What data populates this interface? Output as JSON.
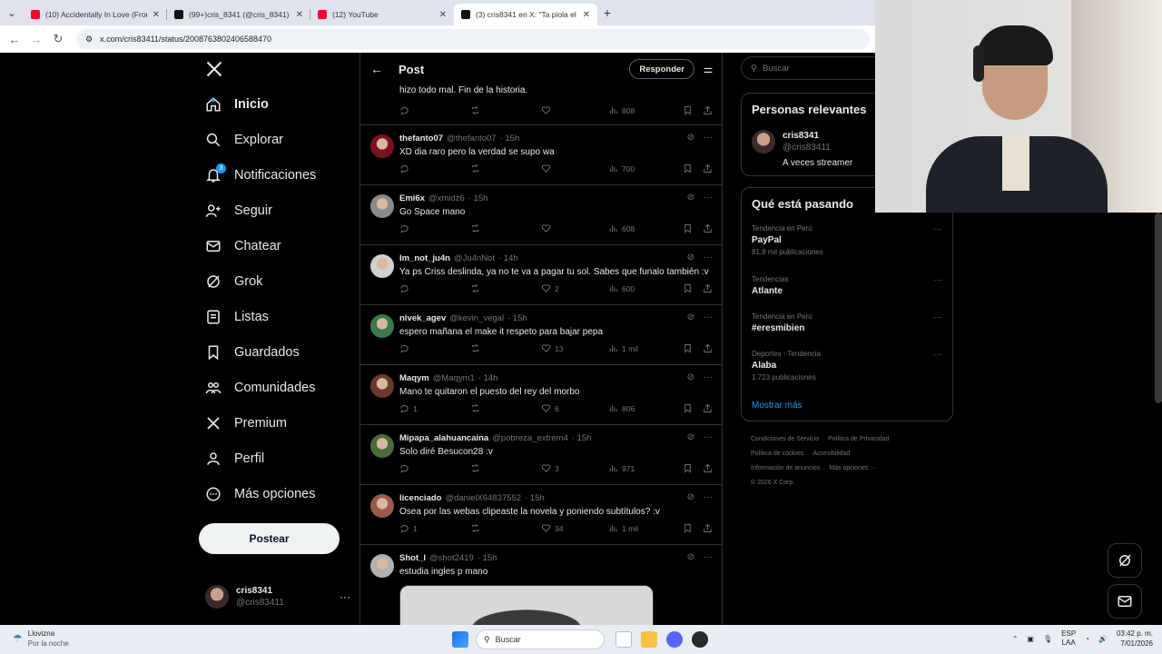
{
  "browser": {
    "tabs": [
      {
        "title": "(10) Accidentally In Love (From",
        "color": "#ff0033"
      },
      {
        "title": "(99+)cris_8341 (@cris_8341) | T",
        "color": "#111111"
      },
      {
        "title": "(12) YouTube",
        "color": "#ff0033"
      },
      {
        "title": "(3) cris8341 en X: \"Ta piola el ch",
        "color": "#111111"
      }
    ],
    "url": "x.com/cris83411/status/2008763802406588470"
  },
  "nav": {
    "items": [
      {
        "label": "Inicio",
        "icon": "home-icon"
      },
      {
        "label": "Explorar",
        "icon": "search-icon"
      },
      {
        "label": "Notificaciones",
        "icon": "bell-icon",
        "badge": "3"
      },
      {
        "label": "Seguir",
        "icon": "add-person-icon"
      },
      {
        "label": "Chatear",
        "icon": "mail-icon"
      },
      {
        "label": "Grok",
        "icon": "grok-icon"
      },
      {
        "label": "Listas",
        "icon": "list-icon"
      },
      {
        "label": "Guardados",
        "icon": "bookmark-icon"
      },
      {
        "label": "Comunidades",
        "icon": "people-icon"
      },
      {
        "label": "Premium",
        "icon": "x-icon"
      },
      {
        "label": "Perfil",
        "icon": "person-icon"
      },
      {
        "label": "Más opciones",
        "icon": "more-circle-icon"
      }
    ],
    "post_label": "Postear",
    "user": {
      "name": "cris8341",
      "handle": "@cris83411"
    }
  },
  "feed": {
    "title": "Post",
    "reply_label": "Responder",
    "partial_text": "hizo todo mal. Fin de la historia.",
    "partial_views": "808",
    "tweets": [
      {
        "name": "thefanto07",
        "handle": "@thefanto07",
        "time": "· 15h",
        "text": "XD dia raro pero la verdad se supo wa",
        "replies": "",
        "likes": "",
        "views": "700",
        "avatar": "#7a1020"
      },
      {
        "name": "Emi6x",
        "handle": "@xmidz6",
        "time": "· 15h",
        "text": "Go Space mano",
        "replies": "",
        "likes": "",
        "views": "608",
        "avatar": "#8a8a8a"
      },
      {
        "name": "Im_not_ju4n",
        "handle": "@Ju4nNot",
        "time": "· 14h",
        "text": "Ya ps Criss deslinda, ya no te va a pagar tu sol. Sabes que funalo también :v",
        "replies": "",
        "likes": "2",
        "views": "600",
        "avatar": "#d0d0d0"
      },
      {
        "name": "nivek_agev",
        "handle": "@kevin_vegal",
        "time": "· 15h",
        "text": "espero mañana el make it respeto para bajar pepa",
        "replies": "",
        "likes": "13",
        "views": "1 mil",
        "avatar": "#3a7a4a"
      },
      {
        "name": "Maqym",
        "handle": "@Maqym1",
        "time": "· 14h",
        "text": "Mano te quitaron el puesto del rey del morbo",
        "replies": "1",
        "likes": "6",
        "views": "806",
        "avatar": "#6a3a2a"
      },
      {
        "name": "Mipapa_alahuancaina",
        "handle": "@pobreza_extrem4",
        "time": "· 15h",
        "text": "Solo diré Besucon28 :v",
        "replies": "",
        "likes": "3",
        "views": "971",
        "avatar": "#4a6a3a"
      },
      {
        "name": "licenciado",
        "handle": "@danielX64837552",
        "time": "· 15h",
        "text": "Osea por las webas clipeaste la novela y poniendo subtítulos? :v",
        "replies": "1",
        "likes": "34",
        "views": "1 mil",
        "avatar": "#9a5a4a"
      },
      {
        "name": "Shot_l",
        "handle": "@shot2419",
        "time": "· 15h",
        "text": "estudia ingles p mano",
        "replies": "",
        "likes": "",
        "views": "",
        "avatar": "#b0b0b0"
      }
    ]
  },
  "sidebar": {
    "search_placeholder": "Buscar",
    "relevant_title": "Personas relevantes",
    "relevant_user": {
      "name": "cris8341",
      "handle": "@cris83411",
      "bio": "A veces streamer"
    },
    "trends_title": "Qué está pasando",
    "trends": [
      {
        "meta": "Tendencia en Perú",
        "topic": "PayPal",
        "count": "81,8 mil publicaciones"
      },
      {
        "meta": "Tendencias",
        "topic": "Atlante",
        "count": ""
      },
      {
        "meta": "Tendencia en Perú",
        "topic": "#eresmibien",
        "count": ""
      },
      {
        "meta": "Deportes · Tendencia",
        "topic": "Alaba",
        "count": "1.723 publicaciones"
      }
    ],
    "show_more": "Mostrar más",
    "footer": [
      "Condiciones de Servicio",
      "Política de Privacidad",
      "Política de cookies",
      "Accesibilidad",
      "Información de anuncios",
      "Más opciones ···",
      "© 2026 X Corp."
    ]
  },
  "taskbar": {
    "weather_title": "Llovizna",
    "weather_sub": "Por la noche",
    "search_label": "Buscar",
    "lang_top": "ESP",
    "lang_bottom": "LAA",
    "time": "03:42 p. m.",
    "date": "7/01/2026"
  }
}
